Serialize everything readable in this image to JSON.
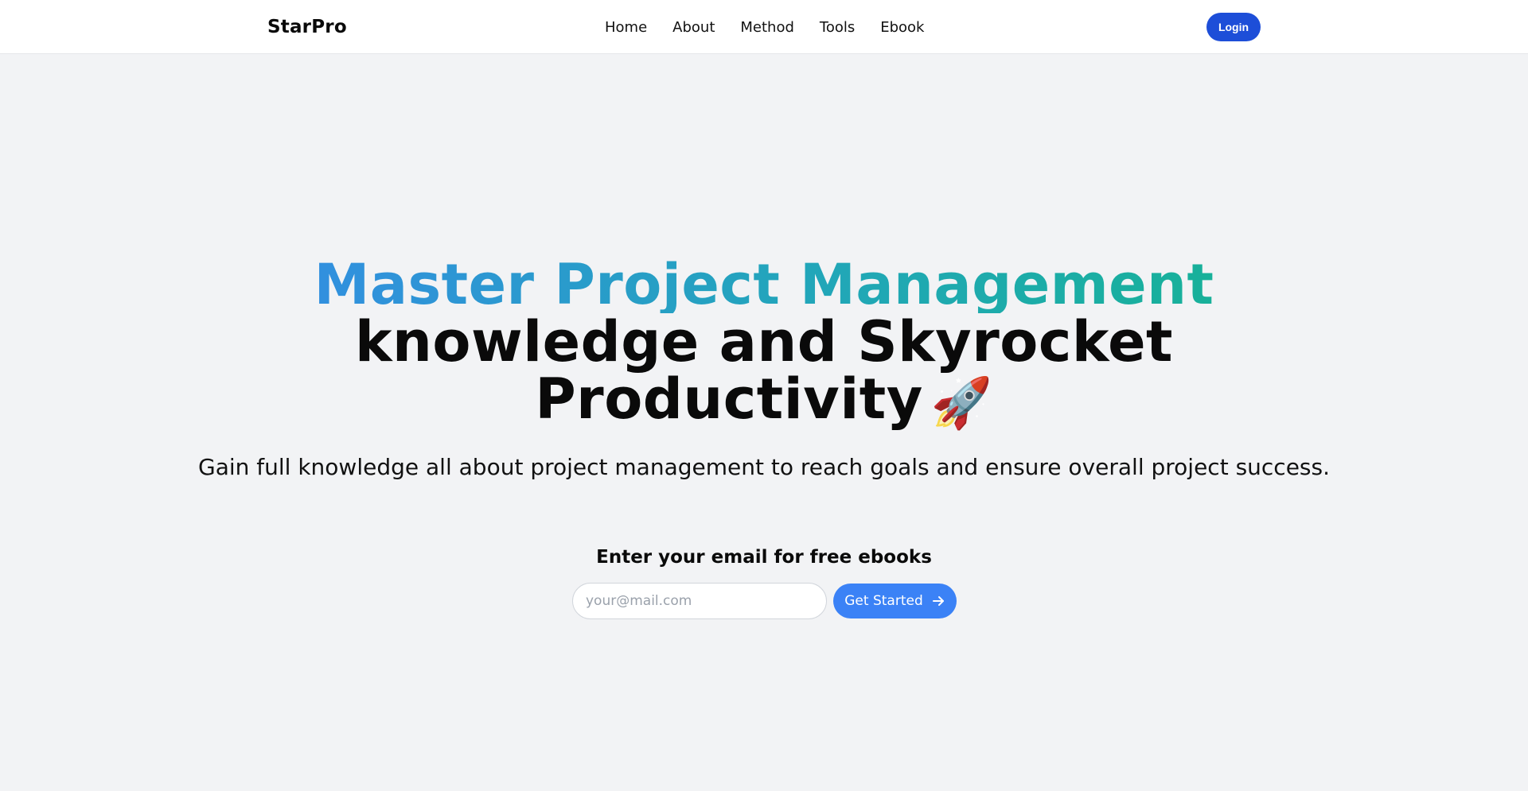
{
  "nav": {
    "brand": "StarPro",
    "links": [
      "Home",
      "About",
      "Method",
      "Tools",
      "Ebook"
    ],
    "login_label": "Login"
  },
  "hero": {
    "headline_gradient": "Master Project Management",
    "headline_line2": "knowledge and Skyrocket",
    "headline_line3": "Productivity",
    "headline_emoji": "🚀",
    "subheadline": "Gain full knowledge all about project management to reach goals and ensure overall project success."
  },
  "signup": {
    "title": "Enter your email for free ebooks",
    "email_value": "",
    "email_placeholder": "your@mail.com",
    "button_label": "Get Started",
    "button_icon": "arrow-right-icon"
  },
  "colors": {
    "background": "#f2f3f5",
    "navbar": "#ffffff",
    "login_button": "#1d4ed8",
    "primary_button": "#3b82f6",
    "gradient_start": "#3b82f6",
    "gradient_end": "#10b981"
  }
}
